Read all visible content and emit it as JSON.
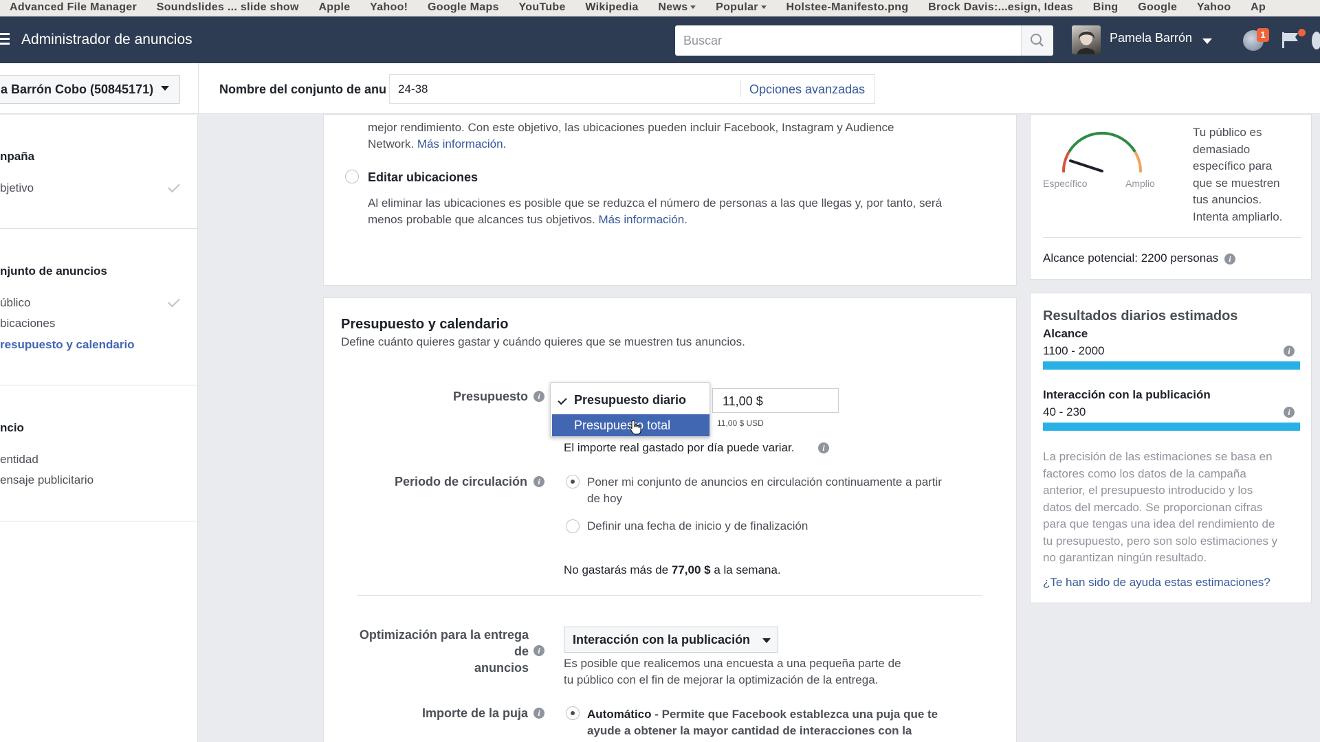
{
  "bookmarks": [
    "Advanced File Manager",
    "Soundslides ... slide show",
    "Apple",
    "Yahoo!",
    "Google Maps",
    "YouTube",
    "Wikipedia",
    "News",
    "Popular",
    "Holstee-Manifesto.png",
    "Brock Davis:...esign, Ideas",
    "Bing",
    "Google",
    "Yahoo",
    "Ap"
  ],
  "header": {
    "app_title": "Administrador de anuncios",
    "search_placeholder": "Buscar",
    "user_name": "Pamela Barrón",
    "notification_count": "1"
  },
  "subheader": {
    "account": "a Barrón Cobo (50845171)",
    "adset_name_label": "Nombre del conjunto de anu",
    "adset_name_value": "24-38",
    "advanced_options": "Opciones avanzadas"
  },
  "sidebar": {
    "campaign_header": "npaña",
    "objective": "bjetivo",
    "adset_header": "njunto de anuncios",
    "audience": "úblico",
    "placements": "bicaciones",
    "budget": "resupuesto y calendario",
    "ad_header": "ncio",
    "identity": "entidad",
    "ad_message": "ensaje publicitario"
  },
  "placements": {
    "text_line1": "mejor rendimiento. Con este objetivo, las ubicaciones pueden incluir Facebook, Instagram y Audience",
    "text_line2": "Network.",
    "more_info": "Más información.",
    "edit_label": "Editar ubicaciones",
    "edit_desc_line1": "Al eliminar las ubicaciones es posible que se reduzca el número de personas a las que llegas y, por tanto, será",
    "edit_desc_line2": "menos probable que alcances tus objetivos.",
    "edit_more_info": "Más información."
  },
  "budget_section": {
    "title": "Presupuesto y calendario",
    "subtitle": "Define cuánto quieres gastar y cuándo quieres que se muestren tus anuncios.",
    "budget_label": "Presupuesto",
    "options": [
      "Presupuesto diario",
      "Presupuesto total"
    ],
    "selected_option": "Presupuesto diario",
    "amount": "11,00 $",
    "amount_usd": "11,00 $ USD",
    "daily_note": "El importe real gastado por día puede variar.",
    "schedule_label": "Periodo de circulación",
    "schedule_opt1_line1": "Poner mi conjunto de anuncios en circulación continuamente a partir",
    "schedule_opt1_line2": "de hoy",
    "schedule_opt2": "Definir una fecha de inicio y de finalización",
    "weekly_prefix": "No gastarás más de",
    "weekly_amount": "77,00 $",
    "weekly_suffix": "a la semana.",
    "optimization_label_line1": "Optimización para la entrega de",
    "optimization_label_line2": "anuncios",
    "optimization_value": "Interacción con la publicación",
    "optimization_note_line1": "Es posible que realicemos una encuesta a una pequeña parte de",
    "optimization_note_line2": "tu público con el fin de mejorar la optimización de la entrega.",
    "bid_label": "Importe de la puja",
    "bid_auto": "Automático",
    "bid_auto_desc_line1": "- Permite que Facebook establezca una puja que te",
    "bid_auto_desc_line2": "ayude a obtener la mayor cantidad de interacciones con la"
  },
  "audience_panel": {
    "gauge_left": "Específico",
    "gauge_right": "Amplio",
    "message_lines": [
      "Tu público es",
      "demasiado",
      "específico para",
      "que se muestren",
      "tus anuncios.",
      "Intenta ampliarlo."
    ],
    "potential_reach": "Alcance potencial: 2200 personas"
  },
  "estimates_panel": {
    "title": "Resultados diarios estimados",
    "reach_label": "Alcance",
    "reach_value": "1100 - 2000",
    "engagement_label": "Interacción con la publicación",
    "engagement_value": "40 - 230",
    "note_lines": [
      "La precisión de las estimaciones se basa en",
      "factores como los datos de la campaña",
      "anterior, el presupuesto introducido y los",
      "datos del mercado. Se proporcionan cifras",
      "para que tengas una idea del rendimiento de",
      "tu presupuesto, pero son solo estimaciones y",
      "no garantizan ningún resultado."
    ],
    "help_link": "¿Te han sido de ayuda estas estimaciones?"
  },
  "colors": {
    "topbar": "#2d3c52",
    "link": "#365899",
    "selected_option": "#4267b2",
    "estimate_bar": "#29b1e5",
    "gauge_green": "#2e8b45",
    "gauge_red": "#d9533b",
    "gauge_orange": "#f0a55a"
  }
}
